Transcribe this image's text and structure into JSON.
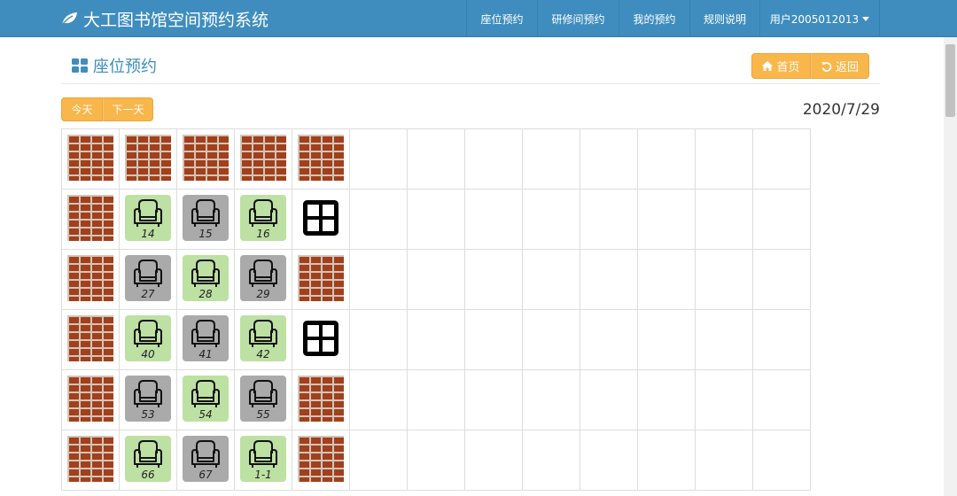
{
  "navbar": {
    "brand": "大工图书馆空间预约系统",
    "items": [
      "座位预约",
      "研修间预约",
      "我的预约",
      "规则说明",
      "用户2005012013"
    ]
  },
  "header": {
    "title": "座位预约",
    "home_label": "首页",
    "back_label": "返回"
  },
  "controls": {
    "today_label": "今天",
    "next_label": "下一天",
    "date": "2020/7/29"
  },
  "colors": {
    "navbar": "#3f8dbf",
    "button": "#f9b64a",
    "seat_available": "#bde0a3",
    "seat_taken": "#aaaaaa",
    "wall": "#a33f1b"
  },
  "grid": {
    "rows": [
      [
        {
          "type": "wall"
        },
        {
          "type": "wall"
        },
        {
          "type": "wall"
        },
        {
          "type": "wall"
        },
        {
          "type": "wall"
        }
      ],
      [
        {
          "type": "wall"
        },
        {
          "type": "seat",
          "status": "available",
          "num": "14"
        },
        {
          "type": "seat",
          "status": "taken",
          "num": "15"
        },
        {
          "type": "seat",
          "status": "available",
          "num": "16"
        },
        {
          "type": "window"
        }
      ],
      [
        {
          "type": "wall"
        },
        {
          "type": "seat",
          "status": "taken",
          "num": "27"
        },
        {
          "type": "seat",
          "status": "available",
          "num": "28"
        },
        {
          "type": "seat",
          "status": "taken",
          "num": "29"
        },
        {
          "type": "wall"
        }
      ],
      [
        {
          "type": "wall"
        },
        {
          "type": "seat",
          "status": "available",
          "num": "40"
        },
        {
          "type": "seat",
          "status": "taken",
          "num": "41"
        },
        {
          "type": "seat",
          "status": "available",
          "num": "42"
        },
        {
          "type": "window"
        }
      ],
      [
        {
          "type": "wall"
        },
        {
          "type": "seat",
          "status": "taken",
          "num": "53"
        },
        {
          "type": "seat",
          "status": "available",
          "num": "54"
        },
        {
          "type": "seat",
          "status": "taken",
          "num": "55"
        },
        {
          "type": "wall"
        }
      ],
      [
        {
          "type": "wall"
        },
        {
          "type": "seat",
          "status": "available",
          "num": "66"
        },
        {
          "type": "seat",
          "status": "taken",
          "num": "67"
        },
        {
          "type": "seat",
          "status": "available",
          "num": "1-1"
        },
        {
          "type": "wall"
        }
      ]
    ]
  }
}
